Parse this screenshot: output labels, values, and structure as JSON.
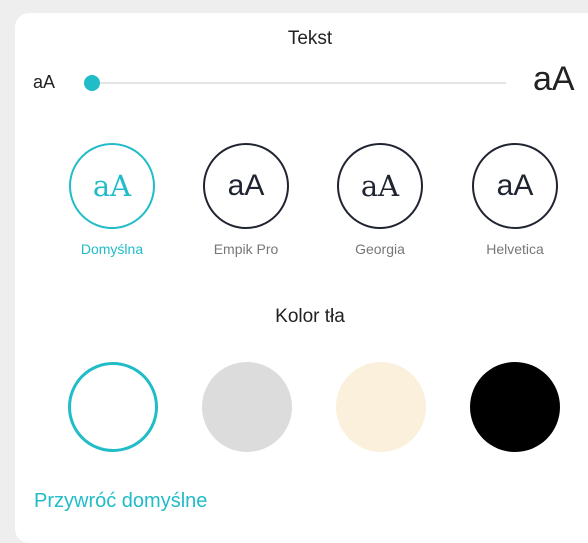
{
  "text_section": {
    "title": "Tekst"
  },
  "size_slider": {
    "small_label": "aA",
    "large_label": "aA",
    "level_percent": 0
  },
  "fonts": [
    {
      "preview": "aA",
      "label": "Domyślna",
      "selected": true
    },
    {
      "preview": "aA",
      "label": "Empik Pro",
      "selected": false
    },
    {
      "preview": "aA",
      "label": "Georgia",
      "selected": false
    },
    {
      "preview": "aA",
      "label": "Helvetica",
      "selected": false
    }
  ],
  "background_section": {
    "title": "Kolor tła"
  },
  "background_colors": [
    {
      "name": "white",
      "color": "#ffffff",
      "selected": true
    },
    {
      "name": "gray",
      "color": "#dcdcdc",
      "selected": false
    },
    {
      "name": "sepia",
      "color": "#faf0dc",
      "selected": false
    },
    {
      "name": "black",
      "color": "#000000",
      "selected": false
    }
  ],
  "reset": {
    "label": "Przywróć domyślne"
  },
  "colors": {
    "accent": "#20bcc8",
    "text": "#1f2430",
    "muted": "#777777"
  }
}
